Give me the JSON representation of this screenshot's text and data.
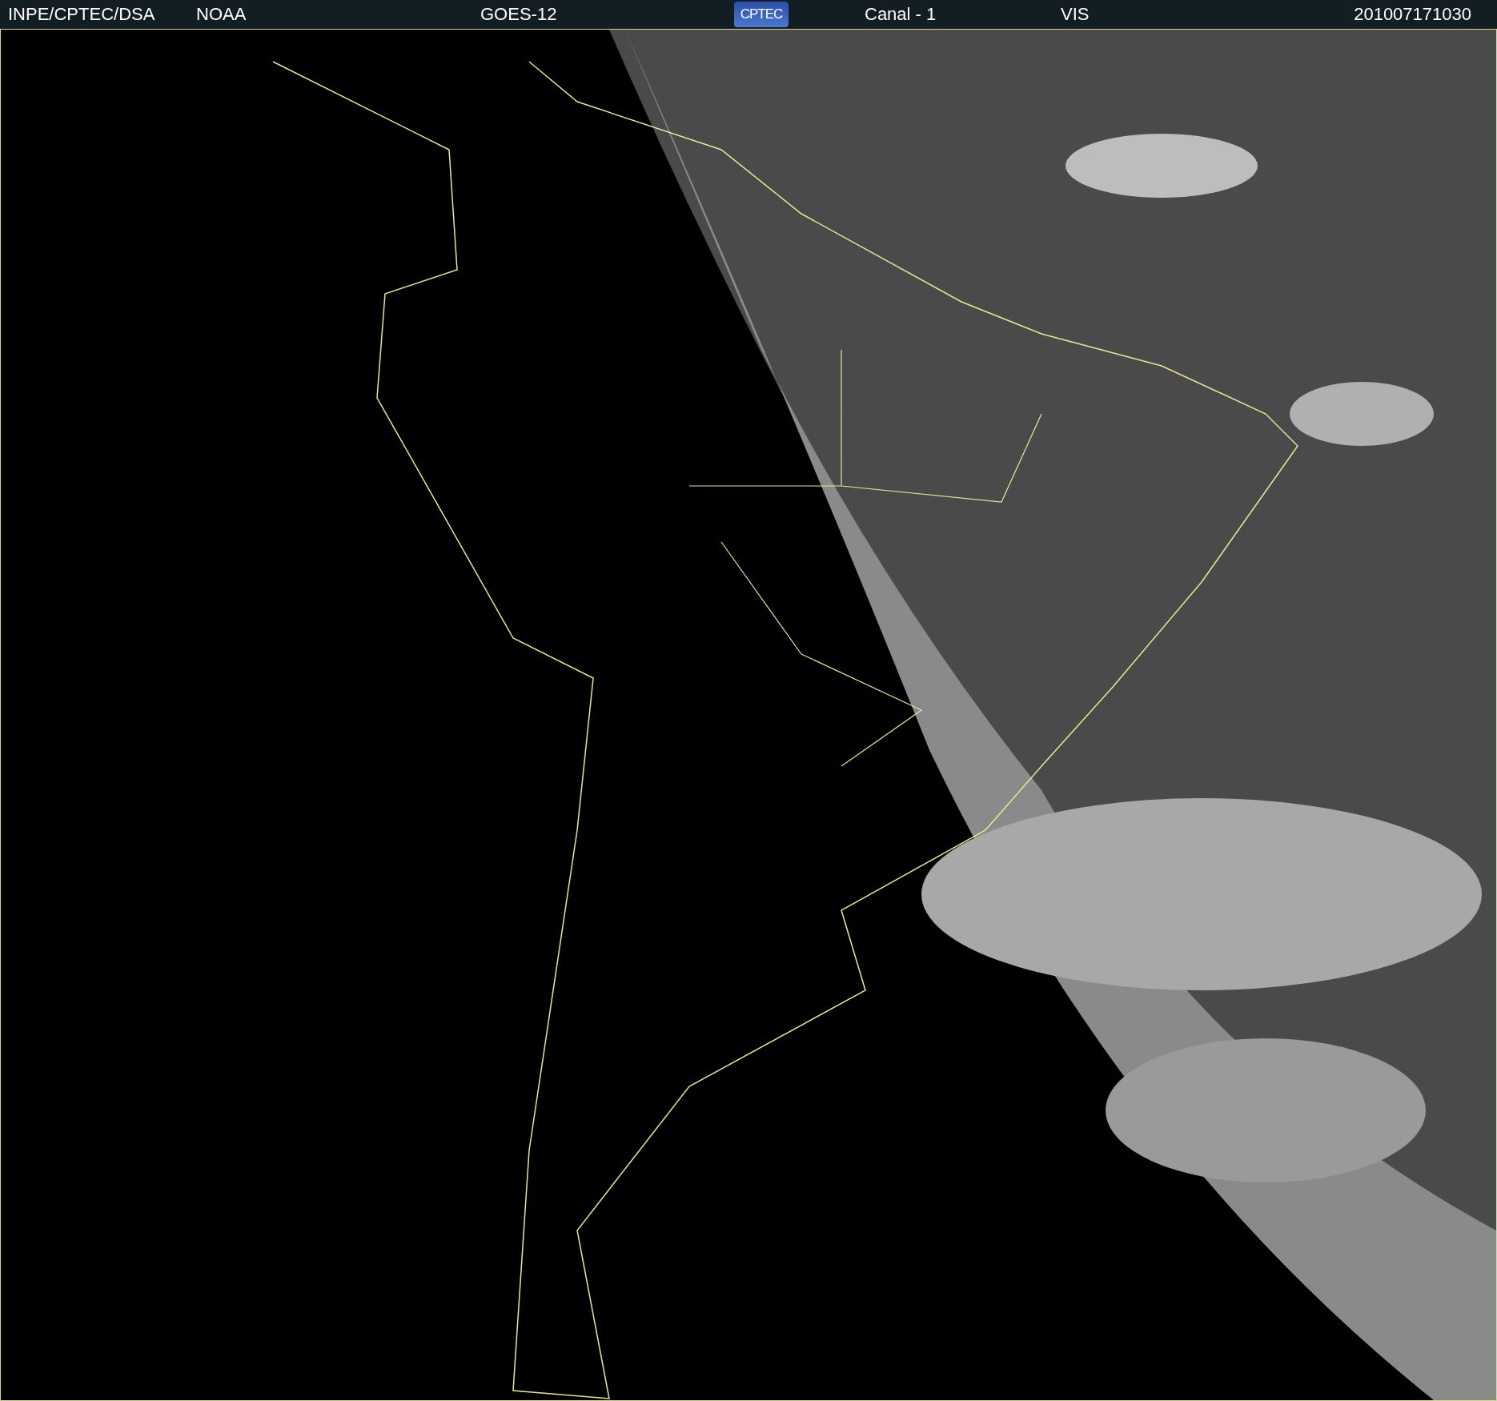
{
  "header": {
    "source": "INPE/CPTEC/DSA",
    "agency": "NOAA",
    "satellite": "GOES-12",
    "logo": "CPTEC",
    "channel": "Canal - 1",
    "band": "VIS",
    "timestamp": "201007171030"
  }
}
